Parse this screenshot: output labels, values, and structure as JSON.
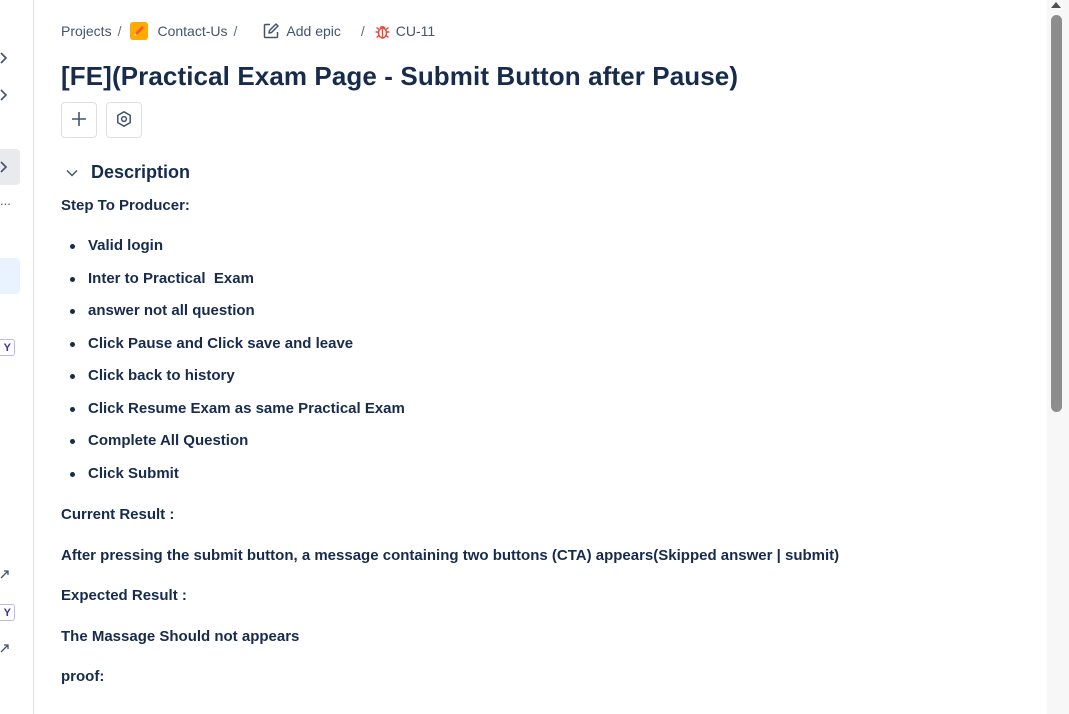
{
  "breadcrumb": {
    "projects": "Projects",
    "separator": "/",
    "project": "Contact-Us",
    "project_icon": "pencil-project-icon",
    "epic": "Add epic",
    "epic_icon": "edit-icon",
    "issue_key": "CU-11",
    "issue_icon": "bug-icon"
  },
  "issue": {
    "title": "[FE](Practical Exam Page - Submit Button after Pause)"
  },
  "actions": {
    "add_icon": "plus-icon",
    "apps_icon": "hexagon-settings-icon"
  },
  "description": {
    "heading": "Description",
    "steps_heading": "Step To Producer:",
    "steps": [
      "Valid login",
      "Inter to Practical  Exam",
      "answer not all question",
      "Click Pause and Click save and leave",
      "Click back to history",
      "Click Resume Exam as same Practical Exam",
      "Complete All Question",
      "Click Submit"
    ],
    "current_result_label": "Current Result :",
    "current_result": "After pressing the submit button, a message containing two buttons (CTA) appears(Skipped answer | submit)",
    "expected_result_label": "Expected Result :",
    "expected_result": "The Massage Should not appears",
    "proof_label": "proof:"
  },
  "sidebar": {
    "badge_1": "Y",
    "badge_2": "Y",
    "more": "..."
  },
  "colors": {
    "text": "#172b4d",
    "breadcrumb_text": "#44546f",
    "bug_red": "#e5493a",
    "project_orange": "#ff8b00",
    "sidebar_selected": "#e9f2ff"
  }
}
